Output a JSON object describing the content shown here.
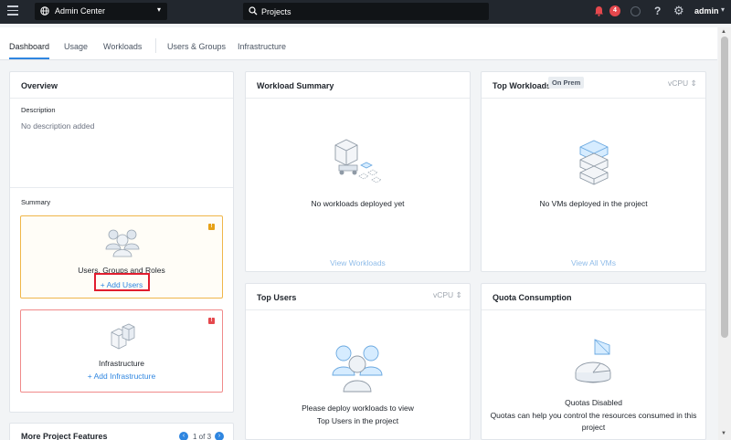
{
  "topbar": {
    "app_title": "Admin Center",
    "search_value": "Projects",
    "alert_count": "4",
    "help_label": "?",
    "user_label": "admin"
  },
  "tabs": [
    "Dashboard",
    "Usage",
    "Workloads",
    "Users & Groups",
    "Infrastructure"
  ],
  "active_tab": "Dashboard",
  "overview": {
    "title": "Overview",
    "description_label": "Description",
    "description_value": "No description added",
    "summary_label": "Summary",
    "users_card": {
      "title": "Users, Groups and Roles",
      "action": "+ Add Users",
      "flag": "!"
    },
    "infra_card": {
      "title": "Infrastructure",
      "action": "+ Add Infrastructure",
      "flag": "!"
    }
  },
  "workload_summary": {
    "title": "Workload Summary",
    "empty_text": "No workloads deployed yet",
    "action": "View Workloads"
  },
  "top_workloads": {
    "title": "Top Workloads",
    "pill": "On Prem",
    "unit": "vCPU",
    "empty_text": "No VMs deployed in the project",
    "action": "View All VMs"
  },
  "top_users": {
    "title": "Top Users",
    "unit": "vCPU",
    "empty_line1": "Please deploy workloads to view",
    "empty_line2": "Top Users in the project"
  },
  "quota": {
    "title": "Quota Consumption",
    "status": "Quotas Disabled",
    "note_line1": "Quotas can help you control the resources consumed in this",
    "note_line2": "project"
  },
  "more_features": {
    "title": "More Project Features",
    "pager": "1 of 3"
  },
  "colors": {
    "topbar": "#22272e",
    "accent": "#2f86e0",
    "warning": "#e6a117",
    "danger": "#e5484d",
    "highlight": "#e11d2e"
  }
}
